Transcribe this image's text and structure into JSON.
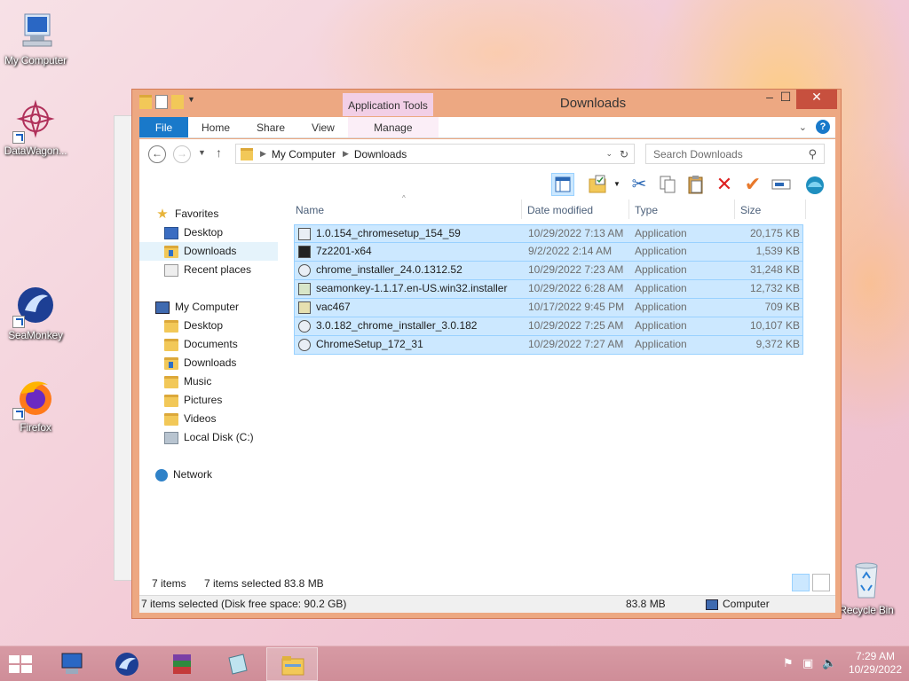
{
  "desktop": {
    "icons": [
      {
        "label": "My Computer",
        "icon": "computer-icon"
      },
      {
        "label": "DataWagon...",
        "icon": "datawagon-icon"
      },
      {
        "label": "SeaMonkey",
        "icon": "seamonkey-icon"
      },
      {
        "label": "Firefox",
        "icon": "firefox-icon"
      },
      {
        "label": "Recycle Bin",
        "icon": "recycle-bin-icon"
      }
    ]
  },
  "window": {
    "title": "Downloads",
    "context_tab": "Application Tools",
    "controls": {
      "minimize": "–",
      "maximize": "☐",
      "close": "✕"
    }
  },
  "ribbon": {
    "tabs": [
      "File",
      "Home",
      "Share",
      "View",
      "Manage"
    ]
  },
  "address": {
    "segments": [
      "My Computer",
      "Downloads"
    ],
    "search_placeholder": "Search Downloads"
  },
  "nav": {
    "favorites": "Favorites",
    "fav_items": [
      "Desktop",
      "Downloads",
      "Recent places"
    ],
    "computer": "My Computer",
    "computer_items": [
      "Desktop",
      "Documents",
      "Downloads",
      "Music",
      "Pictures",
      "Videos",
      "Local Disk (C:)"
    ],
    "network": "Network"
  },
  "list": {
    "columns": {
      "name": "Name",
      "date": "Date modified",
      "type": "Type",
      "size": "Size"
    },
    "rows": [
      {
        "name": "1.0.154_chromesetup_154_59",
        "date": "10/29/2022 7:13 AM",
        "type": "Application",
        "size": "20,175 KB"
      },
      {
        "name": "7z2201-x64",
        "date": "9/2/2022 2:14 AM",
        "type": "Application",
        "size": "1,539 KB"
      },
      {
        "name": "chrome_installer_24.0.1312.52",
        "date": "10/29/2022 7:23 AM",
        "type": "Application",
        "size": "31,248 KB"
      },
      {
        "name": "seamonkey-1.1.17.en-US.win32.installer",
        "date": "10/29/2022 6:28 AM",
        "type": "Application",
        "size": "12,732 KB"
      },
      {
        "name": "vac467",
        "date": "10/17/2022 9:45 PM",
        "type": "Application",
        "size": "709 KB"
      },
      {
        "name": "3.0.182_chrome_installer_3.0.182",
        "date": "10/29/2022 7:25 AM",
        "type": "Application",
        "size": "10,107 KB"
      },
      {
        "name": "ChromeSetup_172_31",
        "date": "10/29/2022 7:27 AM",
        "type": "Application",
        "size": "9,372 KB"
      }
    ]
  },
  "status": {
    "items": "7 items",
    "selected": "7 items selected",
    "selected_size": "83.8 MB",
    "bottom_left": "7 items selected (Disk free space: 90.2 GB)",
    "bottom_size": "83.8 MB",
    "bottom_location": "Computer"
  },
  "taskbar": {
    "time": "7:29 AM",
    "date": "10/29/2022"
  },
  "colors": {
    "window_frame": "#eda882",
    "selection": "#cce8ff",
    "file_tab": "#1979ca",
    "close_button": "#c7503e",
    "taskbar": "#d79aa4"
  }
}
